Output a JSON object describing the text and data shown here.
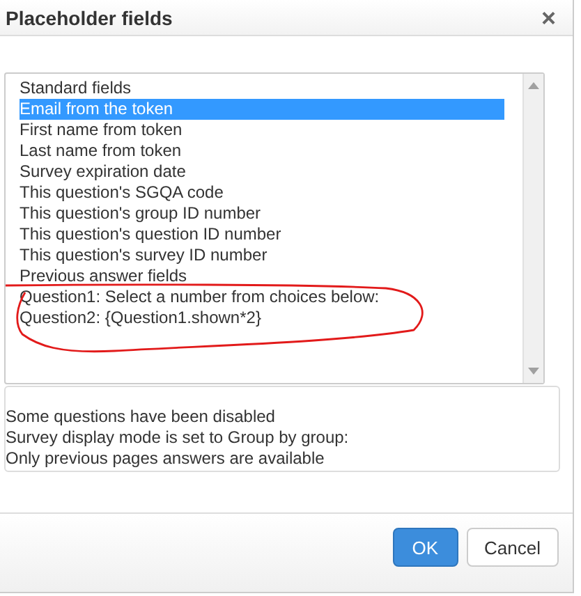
{
  "dialog": {
    "title": "Placeholder fields",
    "close": "×"
  },
  "fields": [
    {
      "label": "Standard fields",
      "selected": false
    },
    {
      "label": "Email from the token",
      "selected": true
    },
    {
      "label": "First name from token",
      "selected": false
    },
    {
      "label": "Last name from token",
      "selected": false
    },
    {
      "label": "Survey expiration date",
      "selected": false
    },
    {
      "label": "This question's SGQA code",
      "selected": false
    },
    {
      "label": "This question's group ID number",
      "selected": false
    },
    {
      "label": "This question's question ID number",
      "selected": false
    },
    {
      "label": "This question's survey ID number",
      "selected": false
    },
    {
      "label": "Previous answer fields",
      "selected": false
    },
    {
      "label": "Question1: Select a number from choices below:",
      "selected": false
    },
    {
      "label": "Question2: {Question1.shown*2}",
      "selected": false
    }
  ],
  "notes": [
    "Some questions have been disabled",
    "Survey display mode is set to Group by group:",
    "Only previous pages answers are available"
  ],
  "buttons": [
    {
      "label": "OK",
      "kind": "primary"
    },
    {
      "label": "Cancel",
      "kind": "default"
    }
  ]
}
